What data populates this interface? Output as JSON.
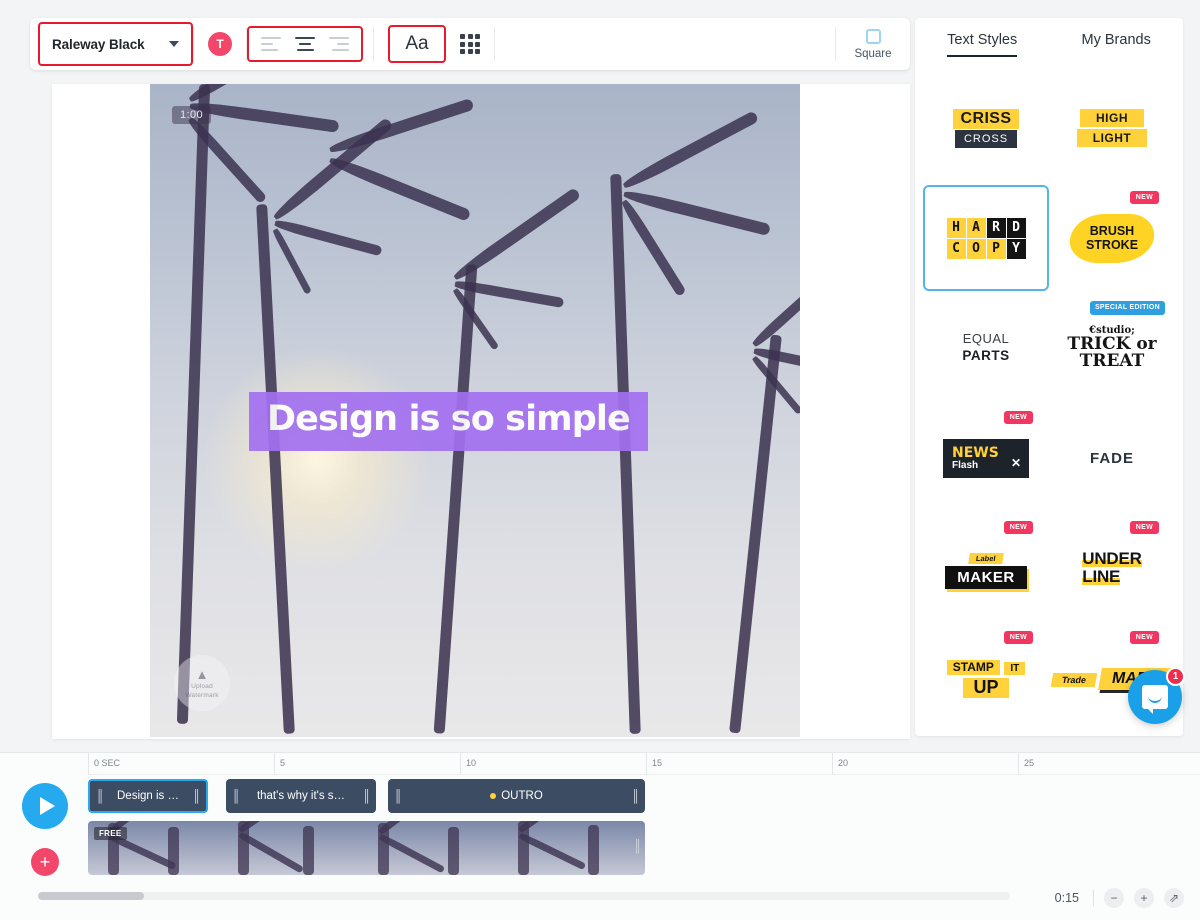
{
  "toolbar": {
    "font_name": "Raleway Black",
    "chevron_icon": "chevron-down-icon",
    "avatar_label": "T",
    "align_left_icon": "align-left-icon",
    "align_center_icon": "align-center-icon",
    "align_right_icon": "align-right-icon",
    "text_case_label": "Aa",
    "grid_icon": "grid-icon",
    "square_label": "Square"
  },
  "canvas": {
    "duration_badge": "1:00",
    "watermark_icon": "upload-icon",
    "watermark_line1": "Upload",
    "watermark_line2": "Watermark",
    "text_layer": "Design is so simple",
    "text_highlight_color": "#a370f0"
  },
  "right_panel": {
    "tabs": [
      {
        "label": "Text Styles",
        "active": true
      },
      {
        "label": "My Brands",
        "active": false
      }
    ],
    "styles": [
      {
        "id": "criss-cross",
        "line1": "CRISS",
        "line2": "CROSS",
        "badge": "",
        "selected": false
      },
      {
        "id": "high-light",
        "line1": "HIGH",
        "line2": "LIGHT",
        "badge": "",
        "selected": false
      },
      {
        "id": "hard-copy",
        "line1": "HARD",
        "line2": "COPY",
        "badge": "",
        "selected": true
      },
      {
        "id": "brush-stroke",
        "line1": "BRUSH",
        "line2": "STROKE",
        "badge": "NEW",
        "selected": false
      },
      {
        "id": "equal-parts",
        "line1": "EQUAL",
        "line2": "PARTS",
        "badge": "",
        "selected": false
      },
      {
        "id": "trick-or-treat",
        "line1": "TRICK or",
        "line2": "TREAT",
        "badge": "SPECIAL EDITION",
        "selected": false
      },
      {
        "id": "news-flash",
        "line1": "NEWS",
        "line2": "Flash",
        "badge": "NEW",
        "selected": false
      },
      {
        "id": "fade",
        "line1": "FADE",
        "line2": "",
        "badge": "",
        "selected": false
      },
      {
        "id": "label-maker",
        "line1": "Label",
        "line2": "MAKER",
        "badge": "NEW",
        "selected": false
      },
      {
        "id": "under-line",
        "line1": "UNDER",
        "line2": "LINE",
        "badge": "NEW",
        "selected": false
      },
      {
        "id": "stamp-it-up",
        "line1": "STAMP",
        "line2": "IT",
        "line3": "UP",
        "badge": "NEW",
        "selected": false
      },
      {
        "id": "trade-mark",
        "line1": "Trade",
        "line2": "MARK",
        "badge": "NEW",
        "selected": false
      }
    ]
  },
  "chat": {
    "icon": "chat-bubble-icon",
    "unread_count": "1"
  },
  "timeline": {
    "play_icon": "play-icon",
    "add_icon": "plus-icon",
    "ruler_ticks": [
      "0 SEC",
      "5",
      "10",
      "15",
      "20",
      "25"
    ],
    "text_clips": [
      {
        "label": "Design is …",
        "selected": true,
        "has_dot": false
      },
      {
        "label": "that's why it's s…",
        "selected": false,
        "has_dot": false
      },
      {
        "label": "OUTRO",
        "selected": false,
        "has_dot": true
      }
    ],
    "video_clip": {
      "tag": "FREE"
    },
    "total_time": "0:15",
    "zoom_out_icon": "minus-icon",
    "zoom_in_icon": "plus-icon",
    "fit_icon": "fit-screen-icon"
  }
}
